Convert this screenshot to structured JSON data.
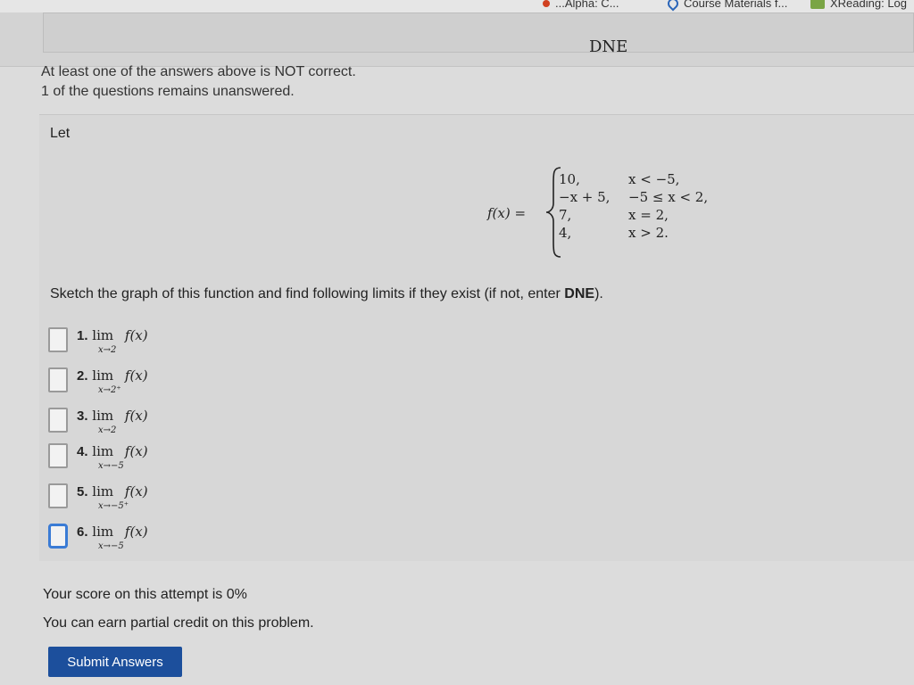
{
  "bookmarks": [
    {
      "label": "...Alpha: C...",
      "icon": "wolfram-icon"
    },
    {
      "label": "Course Materials f...",
      "icon": "pin-icon"
    },
    {
      "label": "XReading: Log",
      "icon": "book-icon"
    }
  ],
  "previous_answer": "DNE",
  "messages": {
    "incorrect": "At least one of the answers above is NOT correct.",
    "unanswered": "1 of the questions remains unanswered."
  },
  "problem": {
    "let": "Let",
    "function_label": "f(x) =",
    "pieces": [
      {
        "value": "10,",
        "condition": "x < −5,"
      },
      {
        "value": "−x + 5,",
        "condition": "−5 ≤ x < 2,"
      },
      {
        "value": "7,",
        "condition": "x = 2,"
      },
      {
        "value": "4,",
        "condition": "x > 2."
      }
    ],
    "instruction_prefix": "Sketch the graph of this function and find following limits if they exist (if not, enter ",
    "instruction_bold": "DNE",
    "instruction_suffix": ")."
  },
  "questions": [
    {
      "number": "1.",
      "lim": "lim",
      "sub": "x→2",
      "f": "f(x)"
    },
    {
      "number": "2.",
      "lim": "lim",
      "sub": "x→2⁺",
      "f": "f(x)"
    },
    {
      "number": "3.",
      "lim": "lim",
      "sub": "x→2",
      "f": "f(x)"
    },
    {
      "number": "4.",
      "lim": "lim",
      "sub": "x→−5",
      "f": "f(x)"
    },
    {
      "number": "5.",
      "lim": "lim",
      "sub": "x→−5⁺",
      "f": "f(x)"
    },
    {
      "number": "6.",
      "lim": "lim",
      "sub": "x→−5",
      "f": "f(x)"
    }
  ],
  "footer": {
    "score": "Your score on this attempt is 0%",
    "partial": "You can earn partial credit on this problem.",
    "submit": "Submit Answers"
  },
  "colors": {
    "submit_bg": "#1c4f9c",
    "focus_border": "#3a7bd5"
  }
}
